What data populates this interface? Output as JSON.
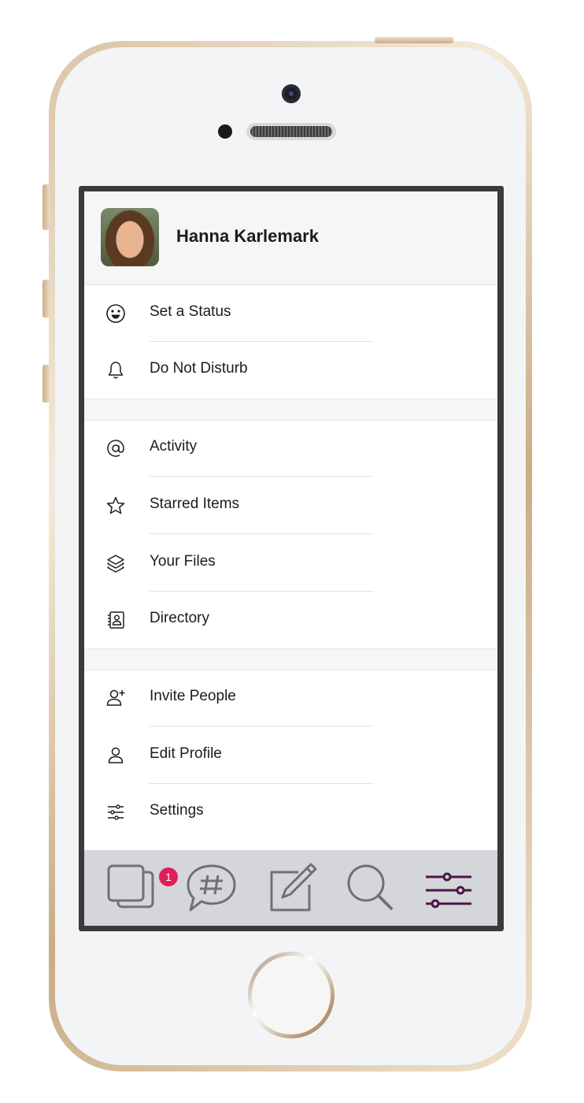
{
  "profile": {
    "name": "Hanna Karlemark"
  },
  "menu": {
    "set_status": "Set a Status",
    "do_not_disturb": "Do Not Disturb",
    "activity": "Activity",
    "starred_items": "Starred Items",
    "your_files": "Your Files",
    "directory": "Directory",
    "invite_people": "Invite People",
    "edit_profile": "Edit Profile",
    "settings": "Settings"
  },
  "tabbar": {
    "home_badge": "1",
    "tabs": [
      "home-icon",
      "channels-icon",
      "compose-icon",
      "search-icon",
      "settings-sliders-icon"
    ],
    "active_tab": "settings-sliders-icon",
    "active_color": "#4a154b",
    "badge_color": "#e01e5a"
  },
  "icons": {
    "set_status": "smiley-icon",
    "do_not_disturb": "bell-icon",
    "activity": "at-sign-icon",
    "starred_items": "star-icon",
    "your_files": "layers-icon",
    "directory": "contact-card-icon",
    "invite_people": "add-user-icon",
    "edit_profile": "user-icon",
    "settings": "sliders-icon"
  }
}
